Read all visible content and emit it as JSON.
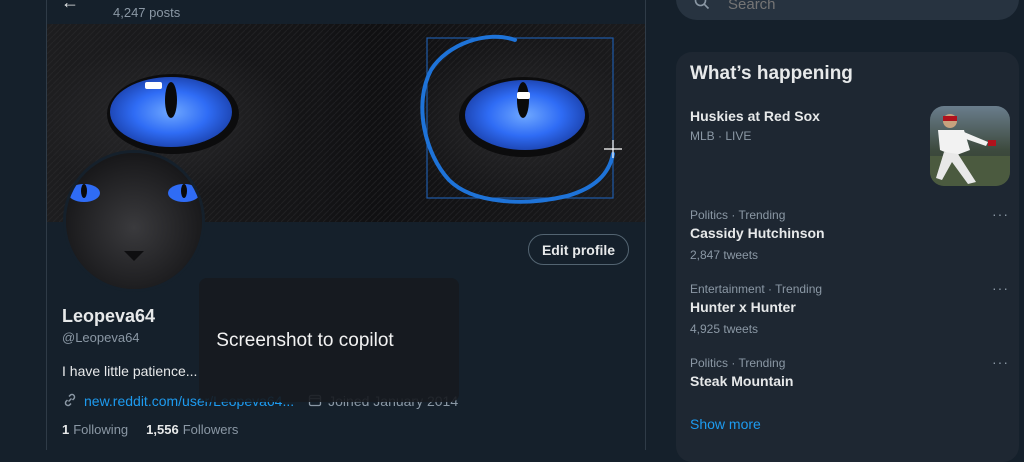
{
  "profile": {
    "post_count": "4,247 posts",
    "display_name": "Leopeva64",
    "handle": "@Leopeva64",
    "bio": "I have little patience...",
    "link_text": "new.reddit.com/user/Leopeva64...",
    "joined": "Joined January 2014",
    "following_count": "1",
    "following_label": "Following",
    "followers_count": "1,556",
    "followers_label": "Followers",
    "edit_profile_label": "Edit profile"
  },
  "overlay": {
    "label": "Screenshot to copilot"
  },
  "search": {
    "placeholder": "Search"
  },
  "trends": {
    "title": "What’s happening",
    "hero": {
      "title": "Huskies at Red Sox",
      "meta": "MLB · LIVE"
    },
    "items": [
      {
        "category": "Politics · Trending",
        "name": "Cassidy Hutchinson",
        "count": "2,847 tweets"
      },
      {
        "category": "Entertainment · Trending",
        "name": "Hunter x Hunter",
        "count": "4,925 tweets"
      },
      {
        "category": "Politics · Trending",
        "name": "Steak Mountain",
        "count": ""
      }
    ],
    "more_icon": "···",
    "show_more": "Show more"
  },
  "icons": {
    "back": "arrow-left-icon",
    "search": "search-icon",
    "link": "link-icon",
    "calendar": "calendar-icon",
    "more": "more-horizontal-icon"
  },
  "colors": {
    "background": "#15202b",
    "panel": "#1e2732",
    "accent": "#1d9bf0",
    "cat_eye": "#2f74ff",
    "annotation": "#1e73d8"
  }
}
